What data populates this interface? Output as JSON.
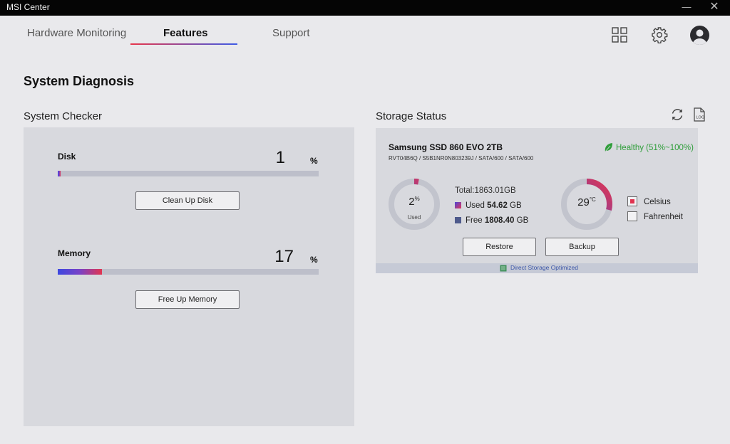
{
  "window": {
    "title": "MSI Center"
  },
  "nav": {
    "tabs": [
      {
        "label": "Hardware Monitoring"
      },
      {
        "label": "Features"
      },
      {
        "label": "Support"
      }
    ],
    "active_tab": "Features",
    "icons": [
      "grid-icon",
      "gear-icon",
      "avatar"
    ]
  },
  "page": {
    "title": "System Diagnosis"
  },
  "system_checker": {
    "title": "System Checker",
    "disk": {
      "label": "Disk",
      "value": "1",
      "unit": "%",
      "level": 0.01,
      "button": "Clean Up Disk"
    },
    "memory": {
      "label": "Memory",
      "value": "17",
      "unit": "%",
      "level": 0.17,
      "button": "Free Up Memory"
    }
  },
  "storage": {
    "title": "Storage Status",
    "icons": [
      "refresh-icon",
      "log-icon"
    ],
    "log_icon_text": "LOG",
    "drive_name": "Samsung SSD 860 EVO 2TB",
    "drive_info": "RVT04B6Q / S5B1NR0N803239J / SATA/600 / SATA/600",
    "health": "Healthy (51%~100%)",
    "usage": {
      "percent": "2",
      "percent_unit": "%",
      "label": "Used",
      "level": 0.03
    },
    "total": "Total:1863.01GB",
    "used": {
      "label": "Used",
      "value": "54.62",
      "unit": "GB"
    },
    "free": {
      "label": "Free",
      "value": "1808.40",
      "unit": "GB"
    },
    "temperature": {
      "value": "29",
      "unit": "°C",
      "level": 0.29
    },
    "units": [
      {
        "label": "Celsius",
        "checked": true
      },
      {
        "label": "Fahrenheit",
        "checked": false
      }
    ],
    "buttons": {
      "restore": "Restore",
      "backup": "Backup"
    },
    "footer": "Direct Storage Optimized"
  },
  "colors": {
    "accent_red": "#e23550",
    "accent_blue": "#3d48e0",
    "health_green": "#2f9e3a",
    "panel_bg": "#d8d9de",
    "titlebar_bg": "#050505"
  }
}
